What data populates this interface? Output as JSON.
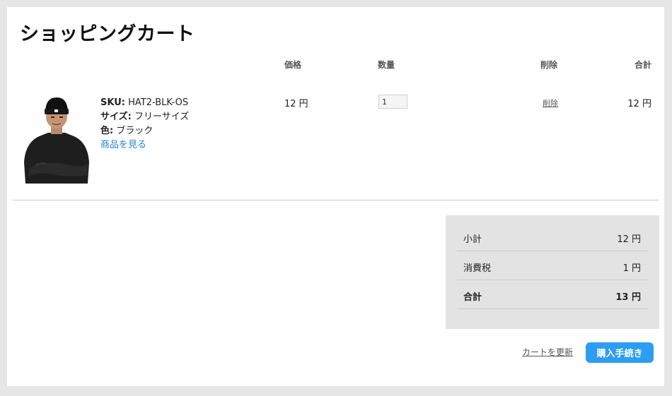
{
  "page": {
    "title": "ショッピングカート"
  },
  "columns": {
    "price": "価格",
    "quantity": "数量",
    "remove": "削除",
    "total": "合計"
  },
  "item": {
    "sku_label": "SKU:",
    "sku_value": "HAT2-BLK-OS",
    "size_label": "サイズ:",
    "size_value": "フリーサイズ",
    "color_label": "色:",
    "color_value": "ブラック",
    "view_link": "商品を見る",
    "price": "12 円",
    "quantity": "1",
    "remove_label": "削除",
    "total": "12 円"
  },
  "summary": {
    "subtotal_label": "小計",
    "subtotal_value": "12 円",
    "tax_label": "消費税",
    "tax_value": "1 円",
    "total_label": "合計",
    "total_value": "13 円"
  },
  "actions": {
    "update_cart": "カートを更新",
    "checkout": "購入手続き"
  },
  "colors": {
    "accent": "#2c9df0",
    "link": "#2a7fd4",
    "summary_bg": "#e3e3e3"
  }
}
